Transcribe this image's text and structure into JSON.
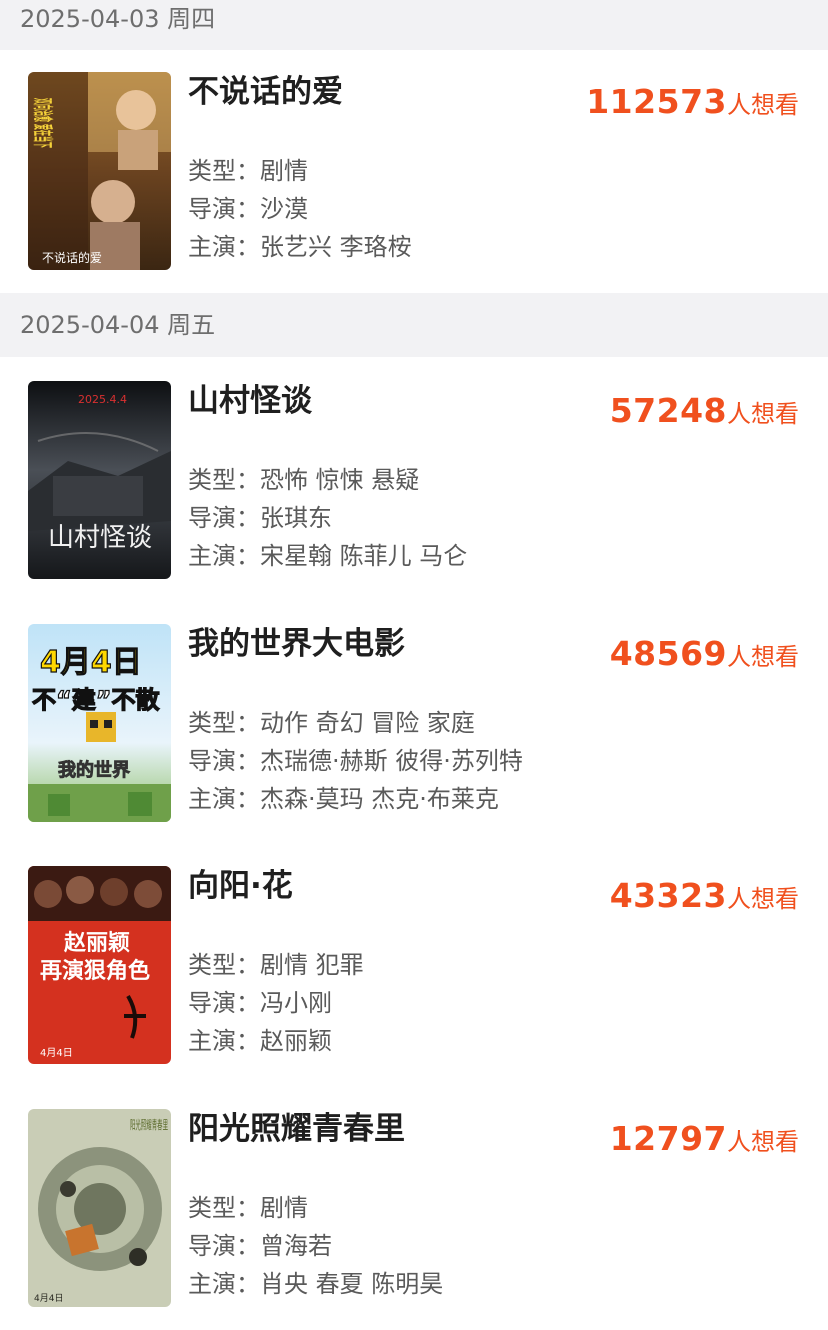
{
  "sections": [
    {
      "date_label": "2025-04-03 周四",
      "movies": [
        {
          "title": "不说话的爱",
          "want_count": "112573",
          "want_unit": "人想看",
          "genre_label": "类型：",
          "genre": "剧情",
          "director_label": "导演：",
          "director": "沙漠",
          "cast_label": "主演：",
          "cast": "张艺兴 李珞桉",
          "poster_text": [
            "双向治愈 爱在当下",
            "小孩姐×爸爸弟",
            "不说话的爱"
          ]
        }
      ]
    },
    {
      "date_label": "2025-04-04 周五",
      "movies": [
        {
          "title": "山村怪谈",
          "want_count": "57248",
          "want_unit": "人想看",
          "genre_label": "类型：",
          "genre": "恐怖 惊悚 悬疑",
          "director_label": "导演：",
          "director": "张琪东",
          "cast_label": "主演：",
          "cast": "宋星翰 陈菲儿 马仑",
          "poster_text": [
            "2025.4.4",
            "山村怪谈"
          ]
        },
        {
          "title": "我的世界大电影",
          "want_count": "48569",
          "want_unit": "人想看",
          "genre_label": "类型：",
          "genre": "动作 奇幻 冒险 家庭",
          "director_label": "导演：",
          "director": "杰瑞德·赫斯 彼得·苏列特",
          "cast_label": "主演：",
          "cast": "杰森·莫玛 杰克·布莱克",
          "poster_text": [
            "4月4日",
            "不“建”不散",
            "我的世界"
          ]
        },
        {
          "title": "向阳·花",
          "want_count": "43323",
          "want_unit": "人想看",
          "genre_label": "类型：",
          "genre": "剧情 犯罪",
          "director_label": "导演：",
          "director": "冯小刚",
          "cast_label": "主演：",
          "cast": "赵丽颖",
          "poster_text": [
            "赵丽颖",
            "再演狠角色",
            "4月4日"
          ]
        },
        {
          "title": "阳光照耀青春里",
          "want_count": "12797",
          "want_unit": "人想看",
          "genre_label": "类型：",
          "genre": "剧情",
          "director_label": "导演：",
          "director": "曾海若",
          "cast_label": "主演：",
          "cast": "肖央 春夏 陈明昊",
          "poster_text": [
            "阳光照耀青春里",
            "4月4日"
          ]
        }
      ]
    }
  ],
  "colors": {
    "accent": "#f0501e",
    "header_bg": "#f2f2f4",
    "title": "#1f1f1f",
    "meta": "#5a5a5a"
  }
}
